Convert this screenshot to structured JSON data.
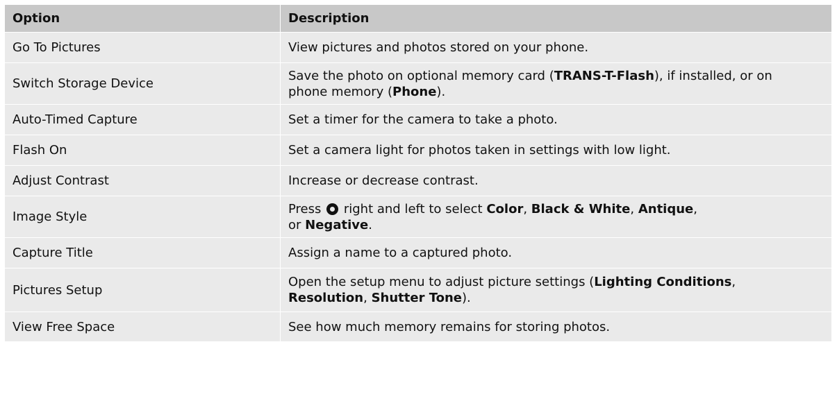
{
  "table": {
    "header": {
      "option": "Option",
      "description": "Description"
    },
    "rows": [
      {
        "option": "Go To Pictures",
        "description": "View pictures and photos stored on your phone."
      },
      {
        "option": "Switch Storage Device",
        "d": [
          "Save the photo on optional memory card (",
          "TRANS-T-Flash",
          "), if installed, or on",
          "phone memory (",
          "Phone",
          ")."
        ]
      },
      {
        "option": "Auto-Timed Capture",
        "description": "Set a timer for the camera to take a photo."
      },
      {
        "option": "Flash On",
        "description": "Set a camera light for photos taken in settings with low light."
      },
      {
        "option": "Adjust Contrast",
        "description": "Increase or decrease contrast."
      },
      {
        "option": "Image Style",
        "d": [
          "Press",
          "right and left to select",
          "Color",
          ",",
          "Black & White",
          ",",
          "Antique",
          ",",
          "or",
          "Negative",
          "."
        ],
        "icon": "navigation-key-icon"
      },
      {
        "option": "Capture Title",
        "description": "Assign a name to a captured photo."
      },
      {
        "option": "Pictures Setup",
        "d": [
          "Open the setup menu to adjust picture settings (",
          "Lighting Conditions",
          ",",
          "Resolution",
          ",",
          "Shutter Tone",
          ")."
        ]
      },
      {
        "option": "View Free Space",
        "description": "See how much memory remains for storing photos."
      }
    ]
  },
  "colors": {
    "header_bg": "#c8c8c8",
    "row_bg": "#eaeaea"
  }
}
